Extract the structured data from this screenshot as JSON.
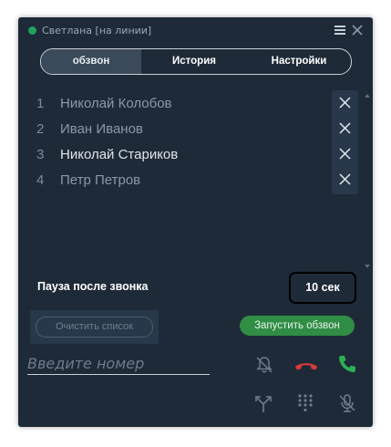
{
  "window": {
    "title": "Светлана [на линии]",
    "status_color": "#1fa35c",
    "icons": {
      "menu": "hamburger-menu-icon",
      "close": "close-icon"
    }
  },
  "tabs": [
    {
      "label": "обзвон",
      "active": true
    },
    {
      "label": "История",
      "active": false
    },
    {
      "label": "Настройки",
      "active": false
    }
  ],
  "contacts": [
    {
      "number": "1",
      "name": "Николай Колобов",
      "current": false
    },
    {
      "number": "2",
      "name": "Иван Иванов",
      "current": false
    },
    {
      "number": "3",
      "name": "Николай Стариков",
      "current": true
    },
    {
      "number": "4",
      "name": "Петр Петров",
      "current": false
    }
  ],
  "pause": {
    "label": "Пауза после звонка",
    "value": "10 сек"
  },
  "buttons": {
    "clear_list": "Очистить список",
    "start_dialing": "Запустить обзвон"
  },
  "phone_input": {
    "placeholder": "Введите номер",
    "value": ""
  },
  "action_icons": [
    "mute-notifications-icon",
    "hangup-icon",
    "call-icon",
    "transfer-icon",
    "dialpad-icon",
    "mute-microphone-icon"
  ],
  "colors": {
    "background": "#1e2a38",
    "accent_green": "#2f8d44",
    "hangup_red": "#d93a3a",
    "call_green": "#2fae55"
  }
}
